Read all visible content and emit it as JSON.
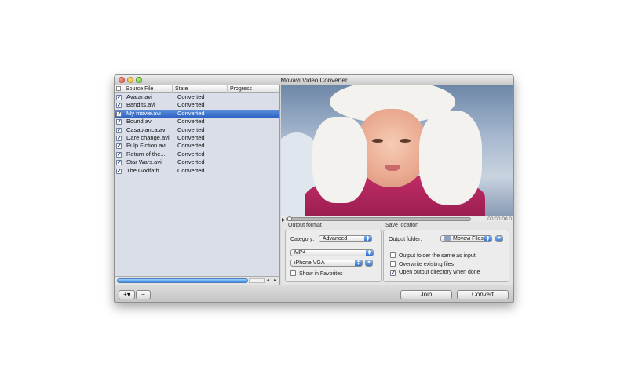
{
  "window": {
    "title": "Movavi Video Converter"
  },
  "file_list": {
    "columns": {
      "source_file": "Source File",
      "state": "State",
      "progress": "Progress"
    },
    "rows": [
      {
        "name": "Avatar.avi",
        "state": "Converted",
        "checked": true,
        "selected": false
      },
      {
        "name": "Bandits.avi",
        "state": "Converted",
        "checked": true,
        "selected": false
      },
      {
        "name": "My movie.avi",
        "state": "Converted",
        "checked": true,
        "selected": true
      },
      {
        "name": "Bound.avi",
        "state": "Converted",
        "checked": true,
        "selected": false
      },
      {
        "name": "Casablanca.avi",
        "state": "Converted",
        "checked": true,
        "selected": false
      },
      {
        "name": "Dare change.avi",
        "state": "Converted",
        "checked": true,
        "selected": false
      },
      {
        "name": "Pulp Fiction.avi",
        "state": "Converted",
        "checked": true,
        "selected": false
      },
      {
        "name": "Return of the...",
        "state": "Converted",
        "checked": true,
        "selected": false
      },
      {
        "name": "Star Wars.avi",
        "state": "Converted",
        "checked": true,
        "selected": false
      },
      {
        "name": "The Godfath...",
        "state": "Converted",
        "checked": true,
        "selected": false
      }
    ],
    "overall_progress": 1.0
  },
  "player": {
    "time": "00:00:00.0",
    "position": 0.0
  },
  "output_format": {
    "title": "Output format",
    "category_label": "Category:",
    "category_value": "Advanced",
    "format_value": "MP4",
    "preset_value": "iPhone VGA",
    "show_in_favorites_label": "Show in Favorites",
    "show_in_favorites": false
  },
  "save_location": {
    "title": "Save location",
    "output_folder_label": "Output folder:",
    "output_folder_value": "Movavi Files",
    "same_as_input_label": "Output folder the same as input",
    "same_as_input": false,
    "overwrite_label": "Overwrite existing files",
    "overwrite": false,
    "open_dir_label": "Open output directory when done",
    "open_dir": true
  },
  "toolbar": {
    "add_label": "+▾",
    "remove_label": "−",
    "join_label": "Join",
    "convert_label": "Convert"
  },
  "colors": {
    "selection": "#2f63c4",
    "accent": "#3a78d6"
  }
}
